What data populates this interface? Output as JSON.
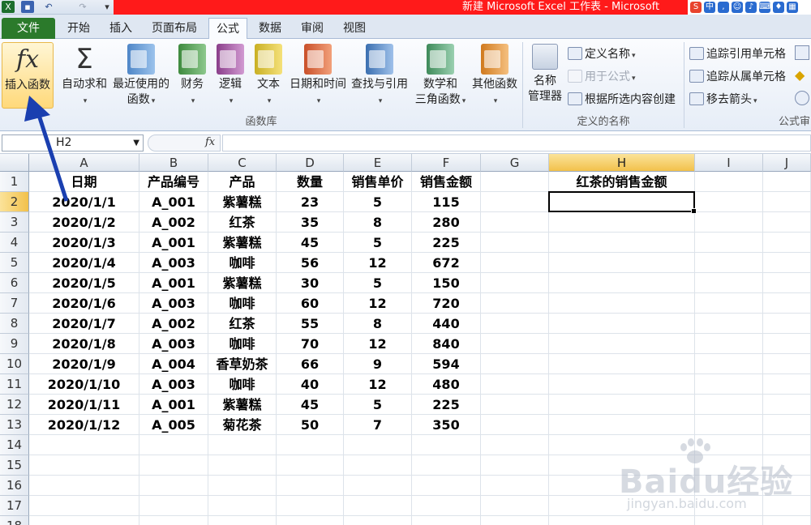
{
  "window": {
    "title": "新建 Microsoft Excel 工作表 - Microsoft"
  },
  "tabs": [
    "文件",
    "开始",
    "插入",
    "页面布局",
    "公式",
    "数据",
    "审阅",
    "视图"
  ],
  "active_tab": "公式",
  "ribbon": {
    "insert_function": "插入函数",
    "function_buttons": [
      {
        "label": "自动求和",
        "sub": ""
      },
      {
        "label": "最近使用的",
        "sub": "函数"
      },
      {
        "label": "财务",
        "sub": ""
      },
      {
        "label": "逻辑",
        "sub": ""
      },
      {
        "label": "文本",
        "sub": ""
      },
      {
        "label": "日期和时间",
        "sub": ""
      },
      {
        "label": "查找与引用",
        "sub": ""
      },
      {
        "label": "数学和",
        "sub": "三角函数"
      },
      {
        "label": "其他函数",
        "sub": ""
      }
    ],
    "function_library_label": "函数库",
    "name_manager": {
      "line1": "名称",
      "line2": "管理器"
    },
    "define_name": "定义名称",
    "use_in_formula": "用于公式",
    "create_from_selection": "根据所选内容创建",
    "defined_names_label": "定义的名称",
    "trace_precedents": "追踪引用单元格",
    "trace_dependents": "追踪从属单元格",
    "remove_arrows": "移去箭头",
    "formula_auditing_label": "公式审"
  },
  "formula_bar": {
    "name_box": "H2",
    "fx_label": "fx",
    "formula": ""
  },
  "sheet": {
    "columns": [
      "A",
      "B",
      "C",
      "D",
      "E",
      "F",
      "G",
      "H",
      "I",
      "J"
    ],
    "selected_column": "H",
    "selected_row": 2,
    "row_numbers": [
      "1",
      "2",
      "3",
      "4",
      "5",
      "6",
      "7",
      "8",
      "9",
      "10",
      "11",
      "12",
      "13",
      "14",
      "15",
      "16",
      "17",
      "18"
    ],
    "headers": [
      "日期",
      "产品编号",
      "产品",
      "数量",
      "销售单价",
      "销售金额"
    ],
    "h1": "红茶的销售金额",
    "rows": [
      [
        "2020/1/1",
        "A_001",
        "紫薯糕",
        "23",
        "5",
        "115"
      ],
      [
        "2020/1/2",
        "A_002",
        "红茶",
        "35",
        "8",
        "280"
      ],
      [
        "2020/1/3",
        "A_001",
        "紫薯糕",
        "45",
        "5",
        "225"
      ],
      [
        "2020/1/4",
        "A_003",
        "咖啡",
        "56",
        "12",
        "672"
      ],
      [
        "2020/1/5",
        "A_001",
        "紫薯糕",
        "30",
        "5",
        "150"
      ],
      [
        "2020/1/6",
        "A_003",
        "咖啡",
        "60",
        "12",
        "720"
      ],
      [
        "2020/1/7",
        "A_002",
        "红茶",
        "55",
        "8",
        "440"
      ],
      [
        "2020/1/8",
        "A_003",
        "咖啡",
        "70",
        "12",
        "840"
      ],
      [
        "2020/1/9",
        "A_004",
        "香草奶茶",
        "66",
        "9",
        "594"
      ],
      [
        "2020/1/10",
        "A_003",
        "咖啡",
        "40",
        "12",
        "480"
      ],
      [
        "2020/1/11",
        "A_001",
        "紫薯糕",
        "45",
        "5",
        "225"
      ],
      [
        "2020/1/12",
        "A_005",
        "菊花茶",
        "50",
        "7",
        "350"
      ]
    ]
  },
  "watermark": {
    "main": "Baidu经验",
    "sub": "jingyan.baidu.com"
  },
  "colors": {
    "file_tab": "#2b7a2b",
    "title_red": "#ff1a1a",
    "selected_header": "#f2c14b",
    "arrow": "#1a3fb0"
  }
}
